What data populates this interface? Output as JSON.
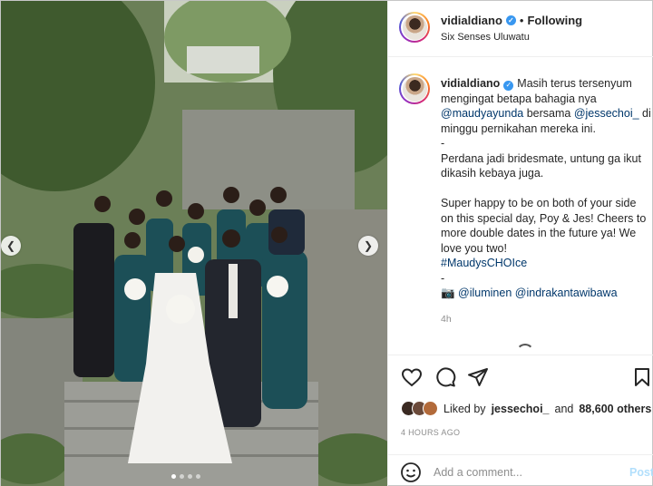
{
  "post": {
    "username": "vidialdiano",
    "separator": "•",
    "follow_label": "Following",
    "location": "Six Senses Uluwatu",
    "caption_lines": [
      {
        "type": "user_text",
        "text": "Masih terus tersenyum"
      },
      {
        "type": "text",
        "text": "mengingat betapa bahagia nya"
      },
      {
        "type": "mixed",
        "parts": [
          {
            "m": true,
            "t": "@maudyayunda"
          },
          {
            "m": false,
            "t": " bersama "
          },
          {
            "m": true,
            "t": "@jessechoi_"
          },
          {
            "m": false,
            "t": " di"
          }
        ]
      },
      {
        "type": "text",
        "text": "minggu pernikahan mereka ini."
      },
      {
        "type": "text",
        "text": "-"
      },
      {
        "type": "text",
        "text": "Perdana jadi bridesmate, untung ga ikut"
      },
      {
        "type": "text",
        "text": "dikasih kebaya juga."
      },
      {
        "type": "blank",
        "text": ""
      },
      {
        "type": "text",
        "text": "Super happy to be on both of your side"
      },
      {
        "type": "text",
        "text": "on this special day, Poy & Jes! Cheers to"
      },
      {
        "type": "text",
        "text": "more double dates in the future ya! We"
      },
      {
        "type": "text",
        "text": "love you two!"
      },
      {
        "type": "mention",
        "text": "#MaudysCHOIce"
      },
      {
        "type": "text",
        "text": "-"
      },
      {
        "type": "mixed",
        "parts": [
          {
            "m": false,
            "t": "📷 "
          },
          {
            "m": true,
            "t": "@iluminen"
          },
          {
            "m": false,
            "t": " "
          },
          {
            "m": true,
            "t": "@indrakantawibawa"
          }
        ]
      }
    ],
    "caption_time": "4h",
    "likes": {
      "prefix": "Liked by",
      "user": "jessechoi_",
      "middle": "and",
      "count": "88,600 others"
    },
    "posted_ago": "4 HOURS AGO",
    "comment_placeholder": "Add a comment...",
    "post_label": "Post",
    "carousel": {
      "total": 4,
      "active": 1
    }
  },
  "icons": {
    "nav_left": "chevron-left-icon",
    "nav_right": "chevron-right-icon",
    "like": "heart-icon",
    "comment": "comment-icon",
    "share": "paper-plane-icon",
    "save": "bookmark-icon",
    "emoji": "smiley-icon",
    "verified": "verified-badge-icon"
  },
  "colors": {
    "mention": "#00376b",
    "verified": "#3897f0",
    "post_button": "#b2dffc",
    "muted": "#8e8e8e"
  }
}
